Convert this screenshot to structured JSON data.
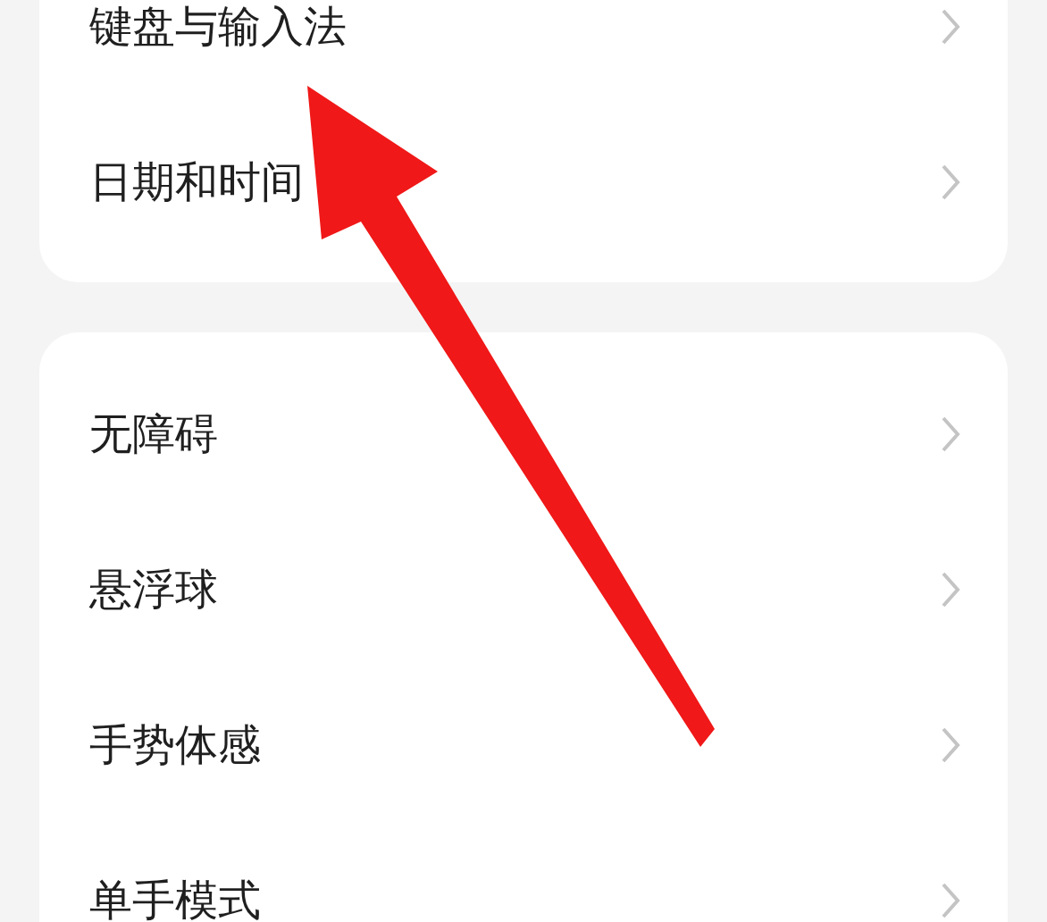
{
  "groups": [
    {
      "items": [
        {
          "label": "键盘与输入法"
        },
        {
          "label": "日期和时间"
        }
      ]
    },
    {
      "items": [
        {
          "label": "无障碍"
        },
        {
          "label": "悬浮球"
        },
        {
          "label": "手势体感"
        },
        {
          "label": "单手模式"
        }
      ]
    }
  ]
}
